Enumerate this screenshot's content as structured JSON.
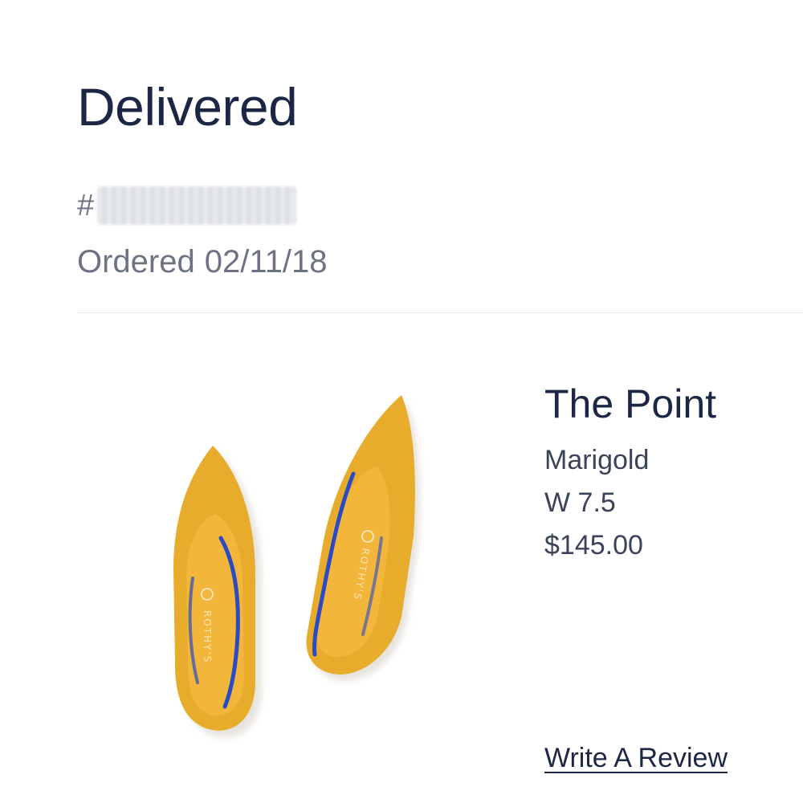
{
  "order": {
    "status": "Delivered",
    "number_prefix": "#",
    "ordered_label": "Ordered",
    "ordered_date": "02/11/18"
  },
  "product": {
    "name": "The Point",
    "color": "Marigold",
    "size": "W 7.5",
    "price": "$145.00",
    "image_icon": "shoe-photo",
    "insole_brand": "ROTHY'S"
  },
  "actions": {
    "review_label": "Write A Review"
  },
  "colors": {
    "heading": "#1c2745",
    "muted": "#6e7384",
    "shoe": "#e8ac2c",
    "accent_blue": "#2b4bc4"
  }
}
